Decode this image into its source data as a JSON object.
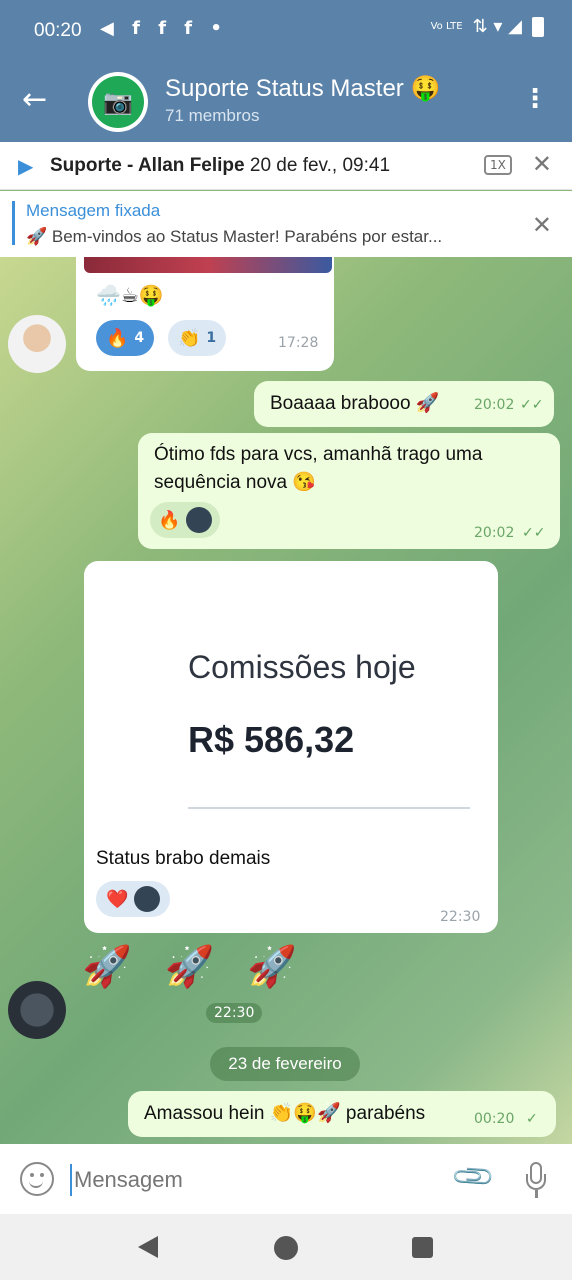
{
  "status_bar": {
    "time": "00:20",
    "left_icons": "◀ f f f •",
    "lte": "Vo\nLTE",
    "right_icons": "⇅ ▾ ◢"
  },
  "header": {
    "back_icon": "←",
    "camera_icon": "📷",
    "title": "Suporte Status Master 🤑",
    "subtitle": "71 membros",
    "menu_icon": "⋮"
  },
  "audio_bar": {
    "play_icon": "▶",
    "sender": "Suporte - Allan Felipe",
    "date": "20 de fev., 09:41",
    "speed": "1X",
    "close_icon": "✕"
  },
  "pinned": {
    "title": "Mensagem fixada",
    "text": "🚀 Bem-vindos ao Status Master!  Parabéns por estar...",
    "close_icon": "✕"
  },
  "messages": [
    {
      "emojis": "🌧️☕🤑",
      "reactions": [
        {
          "emoji": "🔥",
          "count": "4"
        },
        {
          "emoji": "👏",
          "count": "1"
        }
      ],
      "time": "17:28"
    },
    {
      "text": "Boaaaa brabooo 🚀",
      "time": "20:02",
      "check": "✓✓"
    },
    {
      "text": "Ótimo fds para vcs, amanhã trago uma sequência nova 😘",
      "reaction": "🔥",
      "time": "20:02",
      "check": "✓✓"
    },
    {
      "card_title": "Comissões hoje",
      "card_amount": "R$ 586,32",
      "caption": "Status brabo demais",
      "reaction": "❤️",
      "time": "22:30"
    },
    {
      "emojis": "🚀 🚀 🚀",
      "time": "22:30"
    },
    {
      "date_separator": "23 de fevereiro"
    },
    {
      "text": "Amassou hein 👏🤑🚀 parabéns",
      "time": "00:20",
      "check": "✓"
    }
  ],
  "input": {
    "placeholder": "Mensagem",
    "attach_icon": "📎"
  }
}
